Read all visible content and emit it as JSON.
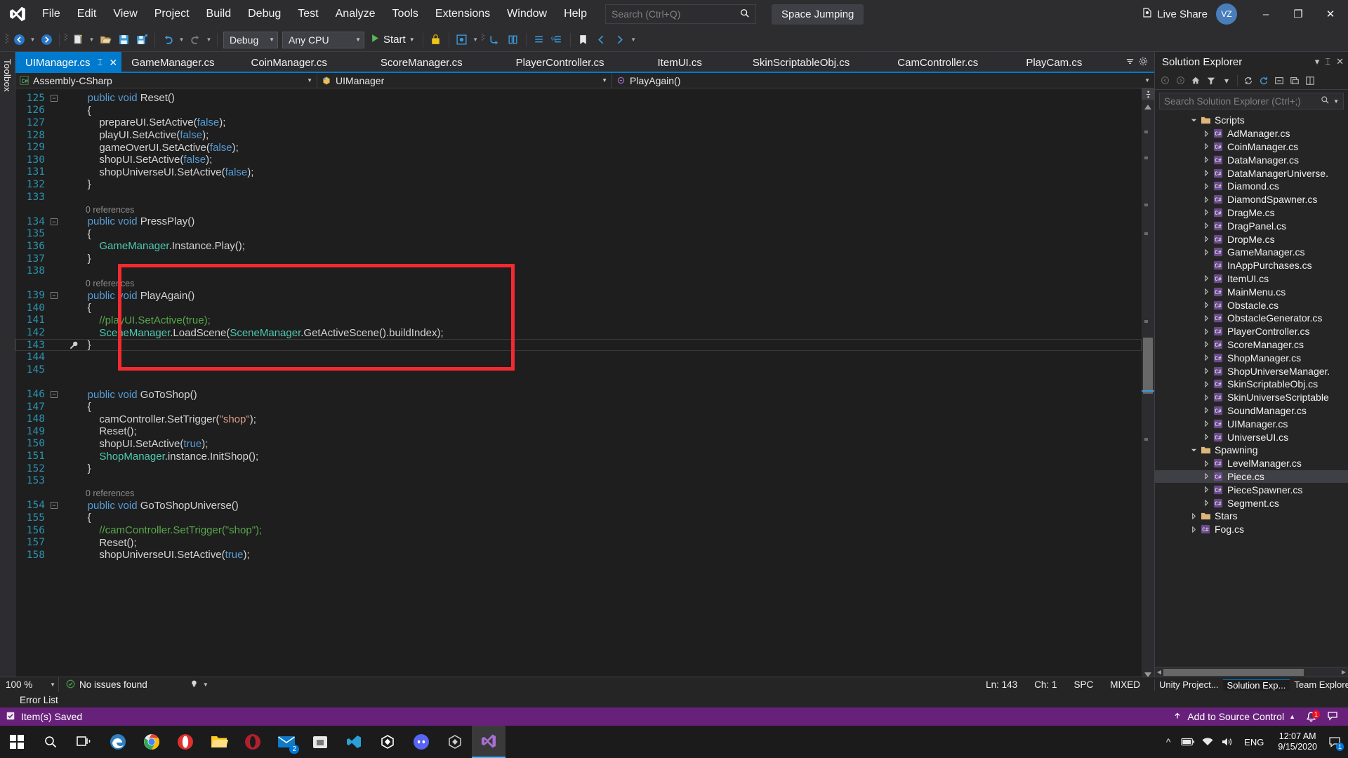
{
  "menubar": {
    "logo": "visual-studio-logo",
    "items": [
      "File",
      "Edit",
      "View",
      "Project",
      "Build",
      "Debug",
      "Test",
      "Analyze",
      "Tools",
      "Extensions",
      "Window",
      "Help"
    ],
    "search_placeholder": "Search (Ctrl+Q)",
    "project_name": "Space Jumping",
    "live_share": "Live Share",
    "account_initials": "VZ",
    "window_buttons": {
      "minimize": "–",
      "maximize": "❐",
      "close": "✕"
    }
  },
  "toolbar": {
    "config": "Debug",
    "platform": "Any CPU",
    "start_label": "Start"
  },
  "toolbox": {
    "label": "Toolbox"
  },
  "tabs": {
    "active_index": 0,
    "items": [
      {
        "label": "UIManager.cs",
        "active": true
      },
      {
        "label": "GameManager.cs",
        "active": false
      },
      {
        "label": "CoinManager.cs",
        "active": false
      },
      {
        "label": "ScoreManager.cs",
        "active": false
      },
      {
        "label": "PlayerController.cs",
        "active": false
      },
      {
        "label": "ItemUI.cs",
        "active": false
      },
      {
        "label": "SkinScriptableObj.cs",
        "active": false
      },
      {
        "label": "CamController.cs",
        "active": false
      },
      {
        "label": "PlayCam.cs",
        "active": false
      }
    ]
  },
  "breadcrumb": {
    "project": "Assembly-CSharp",
    "class": "UIManager",
    "member": "PlayAgain()"
  },
  "code": {
    "lines": [
      {
        "num": "125",
        "fold": "minus",
        "indent": 2,
        "tokens": [
          {
            "t": "public void ",
            "c": "kw"
          },
          {
            "t": "Reset()",
            "c": "pln"
          }
        ]
      },
      {
        "num": "126",
        "fold": "bar",
        "indent": 2,
        "tokens": [
          {
            "t": "{",
            "c": "pln"
          }
        ]
      },
      {
        "num": "127",
        "fold": "bar",
        "indent": 3,
        "tokens": [
          {
            "t": "prepareUI.SetActive(",
            "c": "pln"
          },
          {
            "t": "false",
            "c": "kw"
          },
          {
            "t": ");",
            "c": "pln"
          }
        ]
      },
      {
        "num": "128",
        "fold": "bar",
        "indent": 3,
        "tokens": [
          {
            "t": "playUI.SetActive(",
            "c": "pln"
          },
          {
            "t": "false",
            "c": "kw"
          },
          {
            "t": ");",
            "c": "pln"
          }
        ]
      },
      {
        "num": "129",
        "fold": "bar",
        "indent": 3,
        "tokens": [
          {
            "t": "gameOverUI.SetActive(",
            "c": "pln"
          },
          {
            "t": "false",
            "c": "kw"
          },
          {
            "t": ");",
            "c": "pln"
          }
        ]
      },
      {
        "num": "130",
        "fold": "bar",
        "indent": 3,
        "tokens": [
          {
            "t": "shopUI.SetActive(",
            "c": "pln"
          },
          {
            "t": "false",
            "c": "kw"
          },
          {
            "t": ");",
            "c": "pln"
          }
        ]
      },
      {
        "num": "131",
        "fold": "bar",
        "indent": 3,
        "tokens": [
          {
            "t": "shopUniverseUI.SetActive(",
            "c": "pln"
          },
          {
            "t": "false",
            "c": "kw"
          },
          {
            "t": ");",
            "c": "pln"
          }
        ]
      },
      {
        "num": "132",
        "fold": "bar-end",
        "indent": 2,
        "tokens": [
          {
            "t": "}",
            "c": "pln"
          }
        ]
      },
      {
        "num": "133",
        "fold": "none",
        "indent": 0,
        "tokens": []
      },
      {
        "num": "",
        "fold": "none",
        "indent": 2,
        "refs": "0 references",
        "tokens": []
      },
      {
        "num": "134",
        "fold": "minus",
        "indent": 2,
        "tokens": [
          {
            "t": "public void ",
            "c": "kw"
          },
          {
            "t": "PressPlay()",
            "c": "pln"
          }
        ]
      },
      {
        "num": "135",
        "fold": "bar",
        "indent": 2,
        "tokens": [
          {
            "t": "{",
            "c": "pln"
          }
        ]
      },
      {
        "num": "136",
        "fold": "bar",
        "indent": 3,
        "tokens": [
          {
            "t": "GameManager",
            "c": "typ"
          },
          {
            "t": ".Instance.Play();",
            "c": "pln"
          }
        ]
      },
      {
        "num": "137",
        "fold": "bar-end",
        "indent": 2,
        "tokens": [
          {
            "t": "}",
            "c": "pln"
          }
        ]
      },
      {
        "num": "138",
        "fold": "none",
        "indent": 0,
        "tokens": []
      },
      {
        "num": "",
        "fold": "none",
        "indent": 2,
        "refs": "0 references",
        "tokens": []
      },
      {
        "num": "139",
        "fold": "minus",
        "indent": 2,
        "tokens": [
          {
            "t": "public void ",
            "c": "kw"
          },
          {
            "t": "PlayAgain()",
            "c": "pln"
          }
        ]
      },
      {
        "num": "140",
        "fold": "bar",
        "indent": 2,
        "tokens": [
          {
            "t": "{",
            "c": "pln"
          }
        ]
      },
      {
        "num": "141",
        "fold": "bar",
        "indent": 3,
        "tokens": [
          {
            "t": "//playUI.SetActive(true);",
            "c": "cmt"
          }
        ]
      },
      {
        "num": "142",
        "fold": "bar",
        "indent": 3,
        "changed": true,
        "tokens": [
          {
            "t": "SceneManager",
            "c": "typ"
          },
          {
            "t": ".LoadScene(",
            "c": "pln"
          },
          {
            "t": "SceneManager",
            "c": "typ"
          },
          {
            "t": ".GetActiveScene().buildIndex);",
            "c": "pln"
          }
        ]
      },
      {
        "num": "143",
        "fold": "bar-end",
        "indent": 2,
        "changed": true,
        "current": true,
        "tokens": [
          {
            "t": "}",
            "c": "pln"
          }
        ]
      },
      {
        "num": "144",
        "fold": "none",
        "indent": 0,
        "tokens": []
      },
      {
        "num": "145",
        "fold": "none",
        "indent": 0,
        "tokens": []
      },
      {
        "num": "",
        "fold": "none",
        "indent": 2,
        "refs": "",
        "tokens": []
      },
      {
        "num": "146",
        "fold": "minus",
        "indent": 2,
        "tokens": [
          {
            "t": "public void ",
            "c": "kw"
          },
          {
            "t": "GoToShop()",
            "c": "pln"
          }
        ]
      },
      {
        "num": "147",
        "fold": "bar",
        "indent": 2,
        "tokens": [
          {
            "t": "{",
            "c": "pln"
          }
        ]
      },
      {
        "num": "148",
        "fold": "bar",
        "indent": 3,
        "tokens": [
          {
            "t": "camController.SetTrigger(",
            "c": "pln"
          },
          {
            "t": "\"shop\"",
            "c": "str"
          },
          {
            "t": ");",
            "c": "pln"
          }
        ]
      },
      {
        "num": "149",
        "fold": "bar",
        "indent": 3,
        "tokens": [
          {
            "t": "Reset();",
            "c": "pln"
          }
        ]
      },
      {
        "num": "150",
        "fold": "bar",
        "indent": 3,
        "tokens": [
          {
            "t": "shopUI.SetActive(",
            "c": "pln"
          },
          {
            "t": "true",
            "c": "kw"
          },
          {
            "t": ");",
            "c": "pln"
          }
        ]
      },
      {
        "num": "151",
        "fold": "bar",
        "indent": 3,
        "tokens": [
          {
            "t": "ShopManager",
            "c": "typ"
          },
          {
            "t": ".instance.InitShop();",
            "c": "pln"
          }
        ]
      },
      {
        "num": "152",
        "fold": "bar-end",
        "indent": 2,
        "tokens": [
          {
            "t": "}",
            "c": "pln"
          }
        ]
      },
      {
        "num": "153",
        "fold": "none",
        "indent": 0,
        "tokens": []
      },
      {
        "num": "",
        "fold": "none",
        "indent": 2,
        "refs": "0 references",
        "tokens": []
      },
      {
        "num": "154",
        "fold": "minus",
        "indent": 2,
        "tokens": [
          {
            "t": "public void ",
            "c": "kw"
          },
          {
            "t": "GoToShopUniverse()",
            "c": "pln"
          }
        ]
      },
      {
        "num": "155",
        "fold": "bar",
        "indent": 2,
        "tokens": [
          {
            "t": "{",
            "c": "pln"
          }
        ]
      },
      {
        "num": "156",
        "fold": "bar",
        "indent": 3,
        "tokens": [
          {
            "t": "//camController.SetTrigger(\"shop\");",
            "c": "cmt"
          }
        ]
      },
      {
        "num": "157",
        "fold": "bar",
        "indent": 3,
        "tokens": [
          {
            "t": "Reset();",
            "c": "pln"
          }
        ]
      },
      {
        "num": "158",
        "fold": "bar",
        "indent": 3,
        "tokens": [
          {
            "t": "shopUniverseUI.SetActive(",
            "c": "pln"
          },
          {
            "t": "true",
            "c": "kw"
          },
          {
            "t": ");",
            "c": "pln"
          }
        ]
      }
    ],
    "highlight_note": "red-annotation-box"
  },
  "solution_explorer": {
    "title": "Solution Explorer",
    "search_placeholder": "Search Solution Explorer (Ctrl+;)",
    "tree": [
      {
        "depth": 1,
        "label": "Scripts",
        "icon": "folder-icon",
        "expander": "expanded",
        "selected": false
      },
      {
        "depth": 2,
        "label": "AdManager.cs",
        "icon": "cs-file-icon",
        "expander": "collapsed",
        "selected": false
      },
      {
        "depth": 2,
        "label": "CoinManager.cs",
        "icon": "cs-file-icon",
        "expander": "collapsed",
        "selected": false
      },
      {
        "depth": 2,
        "label": "DataManager.cs",
        "icon": "cs-file-icon",
        "expander": "collapsed",
        "selected": false
      },
      {
        "depth": 2,
        "label": "DataManagerUniverse.",
        "icon": "cs-file-icon",
        "expander": "collapsed",
        "selected": false
      },
      {
        "depth": 2,
        "label": "Diamond.cs",
        "icon": "cs-file-icon",
        "expander": "collapsed",
        "selected": false
      },
      {
        "depth": 2,
        "label": "DiamondSpawner.cs",
        "icon": "cs-file-icon",
        "expander": "collapsed",
        "selected": false
      },
      {
        "depth": 2,
        "label": "DragMe.cs",
        "icon": "cs-file-icon",
        "expander": "collapsed",
        "selected": false
      },
      {
        "depth": 2,
        "label": "DragPanel.cs",
        "icon": "cs-file-icon",
        "expander": "collapsed",
        "selected": false
      },
      {
        "depth": 2,
        "label": "DropMe.cs",
        "icon": "cs-file-icon",
        "expander": "collapsed",
        "selected": false
      },
      {
        "depth": 2,
        "label": "GameManager.cs",
        "icon": "cs-file-icon",
        "expander": "collapsed",
        "selected": false
      },
      {
        "depth": 2,
        "label": "InAppPurchases.cs",
        "icon": "cs-file-icon",
        "expander": "none",
        "selected": false
      },
      {
        "depth": 2,
        "label": "ItemUI.cs",
        "icon": "cs-file-icon",
        "expander": "collapsed",
        "selected": false
      },
      {
        "depth": 2,
        "label": "MainMenu.cs",
        "icon": "cs-file-icon",
        "expander": "collapsed",
        "selected": false
      },
      {
        "depth": 2,
        "label": "Obstacle.cs",
        "icon": "cs-file-icon",
        "expander": "collapsed",
        "selected": false
      },
      {
        "depth": 2,
        "label": "ObstacleGenerator.cs",
        "icon": "cs-file-icon",
        "expander": "collapsed",
        "selected": false
      },
      {
        "depth": 2,
        "label": "PlayerController.cs",
        "icon": "cs-file-icon",
        "expander": "collapsed",
        "selected": false
      },
      {
        "depth": 2,
        "label": "ScoreManager.cs",
        "icon": "cs-file-icon",
        "expander": "collapsed",
        "selected": false
      },
      {
        "depth": 2,
        "label": "ShopManager.cs",
        "icon": "cs-file-icon",
        "expander": "collapsed",
        "selected": false
      },
      {
        "depth": 2,
        "label": "ShopUniverseManager.",
        "icon": "cs-file-icon",
        "expander": "collapsed",
        "selected": false
      },
      {
        "depth": 2,
        "label": "SkinScriptableObj.cs",
        "icon": "cs-file-icon",
        "expander": "collapsed",
        "selected": false
      },
      {
        "depth": 2,
        "label": "SkinUniverseScriptable",
        "icon": "cs-file-icon",
        "expander": "collapsed",
        "selected": false
      },
      {
        "depth": 2,
        "label": "SoundManager.cs",
        "icon": "cs-file-icon",
        "expander": "collapsed",
        "selected": false
      },
      {
        "depth": 2,
        "label": "UIManager.cs",
        "icon": "cs-file-icon",
        "expander": "collapsed",
        "selected": false
      },
      {
        "depth": 2,
        "label": "UniverseUI.cs",
        "icon": "cs-file-icon",
        "expander": "collapsed",
        "selected": false
      },
      {
        "depth": 1,
        "label": "Spawning",
        "icon": "folder-icon",
        "expander": "expanded",
        "selected": false
      },
      {
        "depth": 2,
        "label": "LevelManager.cs",
        "icon": "cs-file-icon",
        "expander": "collapsed",
        "selected": false
      },
      {
        "depth": 2,
        "label": "Piece.cs",
        "icon": "cs-file-icon",
        "expander": "collapsed",
        "selected": true
      },
      {
        "depth": 2,
        "label": "PieceSpawner.cs",
        "icon": "cs-file-icon",
        "expander": "collapsed",
        "selected": false
      },
      {
        "depth": 2,
        "label": "Segment.cs",
        "icon": "cs-file-icon",
        "expander": "collapsed",
        "selected": false
      },
      {
        "depth": 1,
        "label": "Stars",
        "icon": "folder-icon",
        "expander": "collapsed",
        "selected": false
      },
      {
        "depth": 1,
        "label": "Fog.cs",
        "icon": "cs-file-icon",
        "expander": "collapsed",
        "selected": false
      }
    ]
  },
  "statusbar": {
    "zoom": "100 %",
    "issues": "No issues found",
    "line": "Ln: 143",
    "col": "Ch: 1",
    "spaces": "SPC",
    "encoding": "MIXED"
  },
  "bottom_tabs": {
    "error_list": "Error List",
    "panes": [
      {
        "label": "Unity Project...",
        "active": false
      },
      {
        "label": "Solution Exp...",
        "active": true
      },
      {
        "label": "Team Explorer",
        "active": false
      }
    ]
  },
  "vs_status": {
    "saved_text": "Item(s) Saved",
    "source_control": "Add to Source Control",
    "notification_count": "1"
  },
  "taskbar": {
    "apps": [
      {
        "name": "start-button",
        "glyph": "windows-logo"
      },
      {
        "name": "search-icon",
        "glyph": "search"
      },
      {
        "name": "task-view-icon",
        "glyph": "taskview"
      },
      {
        "name": "edge-icon",
        "glyph": "edge"
      },
      {
        "name": "chrome-icon",
        "glyph": "chrome"
      },
      {
        "name": "opera-icon",
        "glyph": "opera"
      },
      {
        "name": "file-explorer-icon",
        "glyph": "folder"
      },
      {
        "name": "opera-gx-icon",
        "glyph": "operagx"
      },
      {
        "name": "mail-icon",
        "glyph": "mail",
        "badge": "2"
      },
      {
        "name": "store-icon",
        "glyph": "store"
      },
      {
        "name": "vscode-icon",
        "glyph": "vscode"
      },
      {
        "name": "unity-hub-icon",
        "glyph": "unity"
      },
      {
        "name": "discord-icon",
        "glyph": "discord"
      },
      {
        "name": "unity-icon",
        "glyph": "unity2"
      },
      {
        "name": "visual-studio-icon",
        "glyph": "vs",
        "active": true
      }
    ],
    "tray": {
      "language": "ENG",
      "time": "12:07 AM",
      "date": "9/15/2020"
    }
  }
}
